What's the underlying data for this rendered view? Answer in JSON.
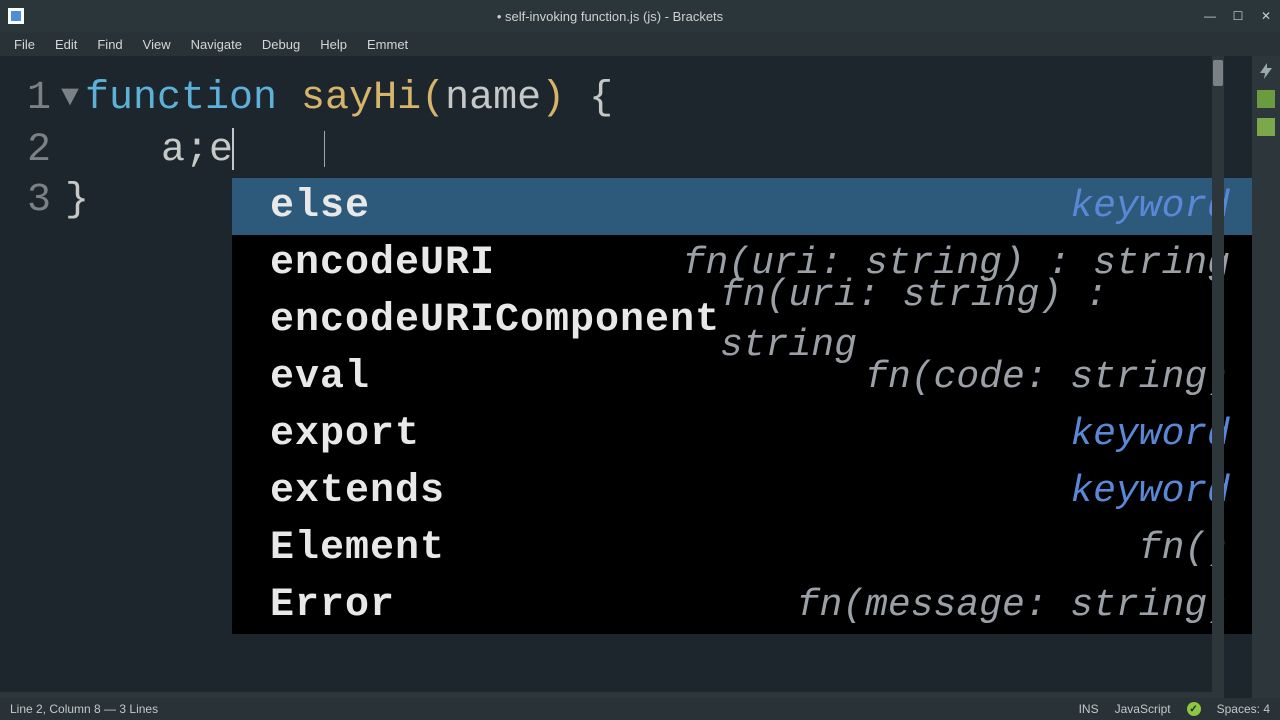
{
  "window": {
    "title": "• self-invoking function.js (js) - Brackets"
  },
  "menu": {
    "file": "File",
    "edit": "Edit",
    "find": "Find",
    "view": "View",
    "navigate": "Navigate",
    "debug": "Debug",
    "help": "Help",
    "emmet": "Emmet"
  },
  "editor": {
    "lines": {
      "l1": "1",
      "l2": "2",
      "l3": "3"
    },
    "code": {
      "function_kw": "function",
      "func_name": " sayHi",
      "paren_open": "(",
      "param": "name",
      "paren_close": ")",
      "brace_open": " {",
      "line2_indent": "    ",
      "line2_text": "a;e",
      "line3": "}"
    }
  },
  "autocomplete": [
    {
      "name": "else",
      "type": "keyword",
      "kw": true
    },
    {
      "name": "encodeURI",
      "type": "fn(uri: string) : string",
      "kw": false
    },
    {
      "name": "encodeURIComponent",
      "type": "fn(uri: string) : string",
      "kw": false
    },
    {
      "name": "eval",
      "type": "fn(code: string)",
      "kw": false
    },
    {
      "name": "export",
      "type": "keyword",
      "kw": true
    },
    {
      "name": "extends",
      "type": "keyword",
      "kw": true
    },
    {
      "name": "Element",
      "type": "fn()",
      "kw": false
    },
    {
      "name": "Error",
      "type": "fn(message: string)",
      "kw": false
    }
  ],
  "status": {
    "left": "Line 2, Column 8 — 3 Lines",
    "ins": "INS",
    "lang": "JavaScript",
    "spaces": "Spaces: 4"
  }
}
